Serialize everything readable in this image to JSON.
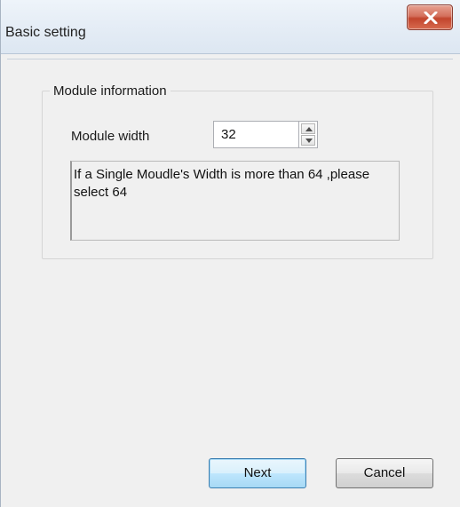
{
  "window": {
    "title": "Basic setting"
  },
  "group": {
    "legend": "Module information",
    "module_width": {
      "label": "Module width",
      "value": "32"
    },
    "note": "If a Single Moudle's Width is more than 64 ,please select 64"
  },
  "buttons": {
    "next": "Next",
    "cancel": "Cancel"
  },
  "colors": {
    "close_button": "#c94a33",
    "default_button_accent": "#3c7fb1",
    "window_background": "#f0f0f0"
  },
  "icons": {
    "close": "close-icon",
    "spin_up": "chevron-up-icon",
    "spin_down": "chevron-down-icon"
  }
}
